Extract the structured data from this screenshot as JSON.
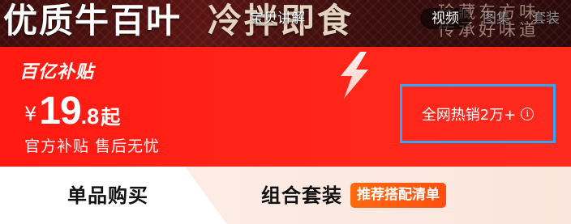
{
  "hero": {
    "title": "优质牛百叶",
    "subtitle": "冷拌即食",
    "slogan_line1": "珍藏东方味",
    "slogan_line2": "传承好味道"
  },
  "media_tabs": {
    "intro": "宝贝讲解",
    "video": "视频",
    "images": "图集",
    "set": "套装"
  },
  "price": {
    "badge": "百亿补贴",
    "currency": "¥",
    "integer": "19",
    "decimal": ".8",
    "suffix": "起",
    "subsidy": "官方补贴 售后无忧"
  },
  "sales": {
    "text": "全网热销2万+",
    "info_icon": "i"
  },
  "purchase_tabs": {
    "single": "单品购买",
    "combo": "组合套装",
    "recommend": "推荐搭配清单"
  },
  "colors": {
    "panel_red": "#ff2418",
    "highlight_border": "#30a8f5",
    "badge_orange": "#ff5a10"
  }
}
